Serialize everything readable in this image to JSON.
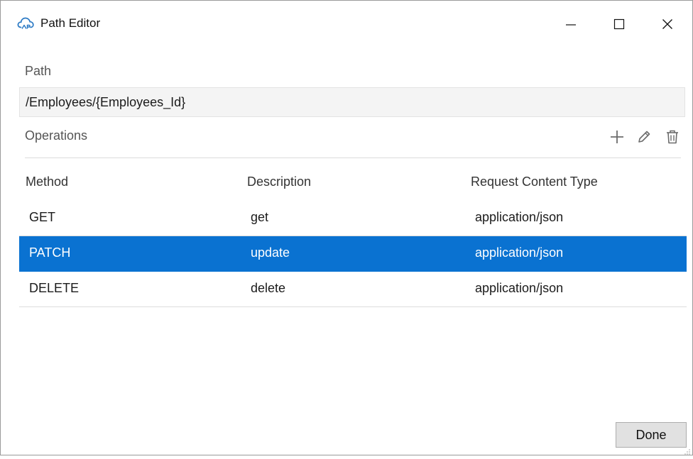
{
  "window": {
    "title": "Path Editor",
    "icon": "cloud-api-icon"
  },
  "path": {
    "label": "Path",
    "value": "/Employees/{Employees_Id}"
  },
  "operations": {
    "label": "Operations",
    "toolbar": [
      "add-icon",
      "edit-icon",
      "delete-icon"
    ]
  },
  "table": {
    "columns": [
      "Method",
      "Description",
      "Request Content Type"
    ],
    "rows": [
      {
        "method": "GET",
        "description": "get",
        "content_type": "application/json",
        "selected": false
      },
      {
        "method": "PATCH",
        "description": "update",
        "content_type": "application/json",
        "selected": true
      },
      {
        "method": "DELETE",
        "description": "delete",
        "content_type": "application/json",
        "selected": false
      }
    ]
  },
  "footer": {
    "done_label": "Done"
  },
  "colors": {
    "selection": "#0a72d1",
    "icon_gray": "#6b6b6b"
  }
}
